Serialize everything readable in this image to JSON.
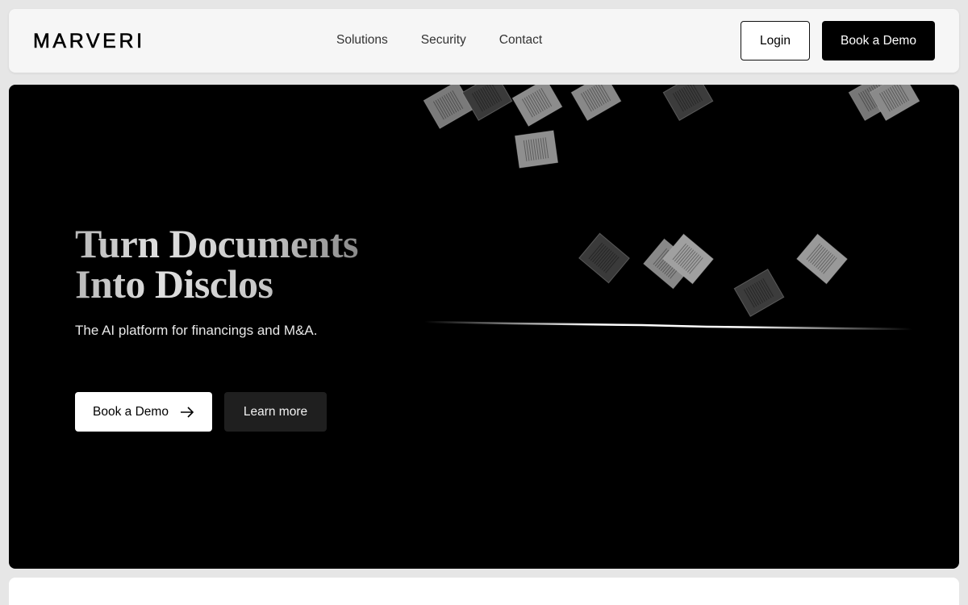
{
  "header": {
    "logo": "MARVERI",
    "nav": [
      "Solutions",
      "Security",
      "Contact"
    ],
    "login_label": "Login",
    "demo_label": "Book a Demo"
  },
  "hero": {
    "title_line1": "Turn Documents",
    "title_line2": "Into Disclos",
    "subtitle": "The AI platform for financings and M&A.",
    "primary_cta": "Book a Demo",
    "secondary_cta": "Learn more"
  },
  "icons": {
    "arrow": "arrow-right-icon",
    "documents": "document-icon"
  },
  "colors": {
    "background": "#e6e6e6",
    "navbar": "#f6f6f6",
    "hero": "#000000",
    "primary_button": "#000000",
    "secondary_button": "#1f1f1f"
  }
}
